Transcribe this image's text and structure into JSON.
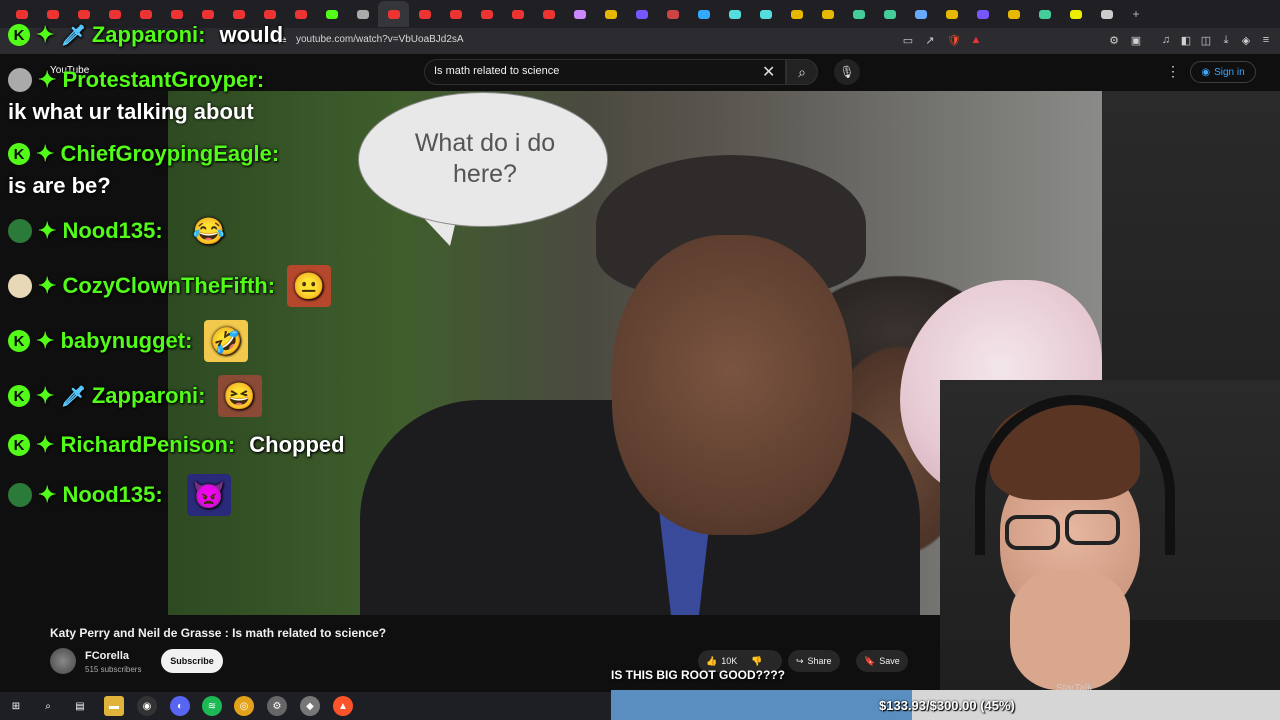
{
  "browser": {
    "url": "youtube.com/watch?v=VbUoaBJd2sA",
    "tabs_count": 36
  },
  "youtube": {
    "logo_text": "YouTube",
    "search_query": "Is math related to science",
    "sign_in_label": "Sign in",
    "video_title": "Katy Perry and Neil de Grasse : Is math related to science?",
    "channel_name": "FCorella",
    "channel_subs": "515 subscribers",
    "subscribe_label": "Subscribe",
    "like_count": "10K",
    "share_label": "Share",
    "save_label": "Save"
  },
  "video": {
    "speech_bubble": "What do i do here?"
  },
  "chat": {
    "top_partial": {
      "user": "Zapparoni:",
      "message": "would"
    },
    "lines": [
      {
        "user": "ProtestantGroyper:",
        "badge": "avatar",
        "message_line": "ik what ur talking about"
      },
      {
        "user": "ChiefGroypingEagle:",
        "badge": "k",
        "message_line": "is are be?"
      },
      {
        "user": "Nood135:",
        "badge": "avatar-green",
        "emote": "laugh-emote"
      },
      {
        "user": "CozyClownTheFifth:",
        "badge": "avatar-clown",
        "emote": "face-emote"
      },
      {
        "user": "babynugget:",
        "badge": "k",
        "emote": "crying-laugh-emote"
      },
      {
        "user": "Zapparoni:",
        "badge": "k-sword",
        "emote": "cheering-man-emote"
      },
      {
        "user": "RichardPenison:",
        "badge": "k",
        "message": "Chopped"
      },
      {
        "user": "Nood135:",
        "badge": "avatar-green",
        "emote": "creepy-sonic-emote"
      }
    ]
  },
  "stream_overlay": {
    "caption": "IS THIS BIG ROOT GOOD????",
    "donation_text": "$133.93/$300.00 (45%)",
    "donation_progress": 0.45,
    "startalk_label": "StarTalk"
  },
  "colors": {
    "kick_green": "#53fc18",
    "yt_blue": "#3ea6ff",
    "donation_fill": "#5b8ec0"
  }
}
